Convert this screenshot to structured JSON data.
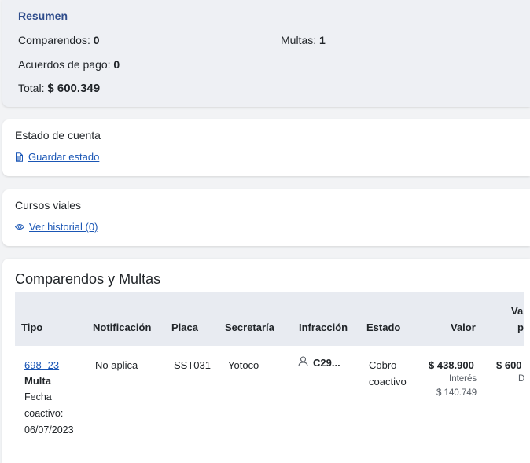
{
  "summary": {
    "title": "Resumen",
    "comparendos_label": "Comparendos:",
    "comparendos_value": "0",
    "multas_label": "Multas:",
    "multas_value": "1",
    "acuerdos_label": "Acuerdos de pago:",
    "acuerdos_value": "0",
    "total_label": "Total:",
    "total_value": "$ 600.349"
  },
  "estado_cuenta": {
    "title": "Estado de cuenta",
    "link": "Guardar estado",
    "icon": "document-icon"
  },
  "cursos": {
    "title": "Cursos viales",
    "link": "Ver historial (0)",
    "icon": "eye-icon"
  },
  "comparendos": {
    "title": "Comparendos y Multas",
    "headers": {
      "tipo": "Tipo",
      "notificacion": "Notificación",
      "placa": "Placa",
      "secretaria": "Secretaría",
      "infraccion": "Infracción",
      "estado": "Estado",
      "valor": "Valor",
      "valor_pagar_line1": "Va",
      "valor_pagar_line2": "p"
    },
    "rows": [
      {
        "numero": "698 -23",
        "tipo": "Multa",
        "fecha_line1": "Fecha",
        "fecha_line2": "coactivo:",
        "fecha_line3": "06/07/2023",
        "notificacion": "No aplica",
        "placa": "SST031",
        "secretaria": "Yotoco",
        "infraccion": "C29...",
        "estado_line1": "Cobro",
        "estado_line2": "coactivo",
        "valor": "$ 438.900",
        "interes_label": "Interés",
        "interes_value": "$ 140.749",
        "valor_pagar": "$ 600",
        "valor_pagar_sub": "D"
      }
    ]
  },
  "colors": {
    "link": "#1a56b5",
    "summary_title": "#2f4d8c",
    "summary_bg": "#eef0f4",
    "table_header_bg": "#e8ebf1"
  }
}
